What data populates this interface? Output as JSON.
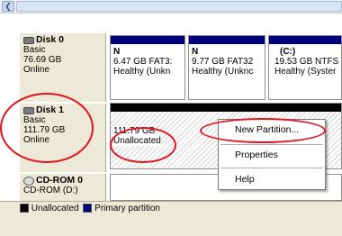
{
  "disks": [
    {
      "name": "Disk 0",
      "type": "Basic",
      "size": "76.69 GB",
      "status": "Online",
      "icon": "hard-disk-icon",
      "partitions": [
        {
          "letter": "N",
          "size_fs": "6.47 GB FAT3:",
          "status": "Healthy (Unkn"
        },
        {
          "letter": "N",
          "size_fs": "9.77 GB FAT32",
          "status": "Healthy (Unknc"
        },
        {
          "letter": "(C:)",
          "size_fs": "19.53 GB NTFS",
          "status": "Healthy (Syster"
        }
      ]
    },
    {
      "name": "Disk 1",
      "type": "Basic",
      "size": "111.79 GB",
      "status": "Online",
      "icon": "hard-disk-icon",
      "unallocated": {
        "size": "111.79 GB",
        "label": "Unallocated"
      }
    },
    {
      "name": "CD-ROM 0",
      "type": "CD-ROM (D:)",
      "icon": "cdrom-icon"
    }
  ],
  "context_menu": {
    "items": [
      "New Partition...",
      "Properties",
      "Help"
    ]
  },
  "legend": {
    "items": [
      {
        "label": "Unallocated",
        "color": "#000000"
      },
      {
        "label": "Primary partition",
        "color": "#00007a"
      }
    ]
  },
  "colors": {
    "annotation": "#e0141e",
    "primary_header": "#00007a",
    "unallocated_header": "#000000"
  }
}
